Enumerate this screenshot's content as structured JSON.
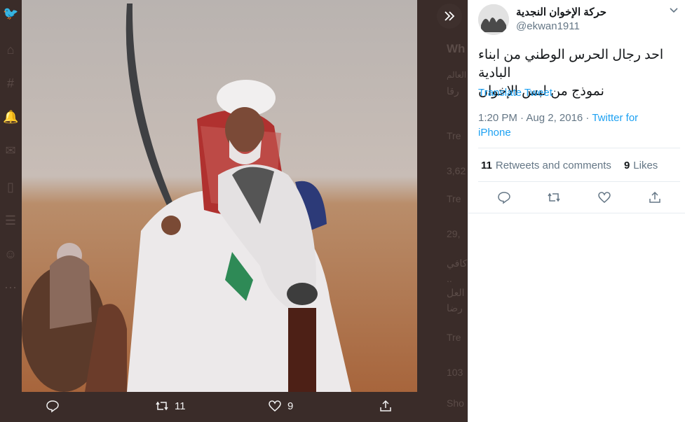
{
  "background": {
    "nav_icons": [
      "twitter-icon",
      "home-icon",
      "hashtag-icon",
      "bell-icon",
      "mail-icon",
      "bookmark-icon",
      "list-icon",
      "profile-icon",
      "more-icon"
    ],
    "feed_texts": [
      "Wh",
      "العالم",
      "رقا",
      "Tre",
      "3,62",
      "Tre",
      "29,",
      "كافي",
      "..",
      "العل",
      "رضا",
      "Tre",
      "103",
      "Sho"
    ]
  },
  "photo": {
    "description_icon": "photo"
  },
  "photo_actions": {
    "retweets": "11",
    "likes": "9"
  },
  "tweet": {
    "display_name": "حركة الإخوان النجدية",
    "handle": "@ekwan1911",
    "text_line1": "احد رجال الحرس الوطني من ابناء البادية",
    "text_line2": "نموذج من لبس الإخوان",
    "translate_label": "Translate Tweet",
    "timestamp": "1:20 PM · Aug 2, 2016 · ",
    "source": "Twitter for iPhone",
    "retweets_count": "11",
    "retweets_label": "Retweets and comments",
    "likes_count": "9",
    "likes_label": "Likes"
  },
  "colors": {
    "accent": "#1da1f2",
    "overlay": "#3a2c29"
  }
}
